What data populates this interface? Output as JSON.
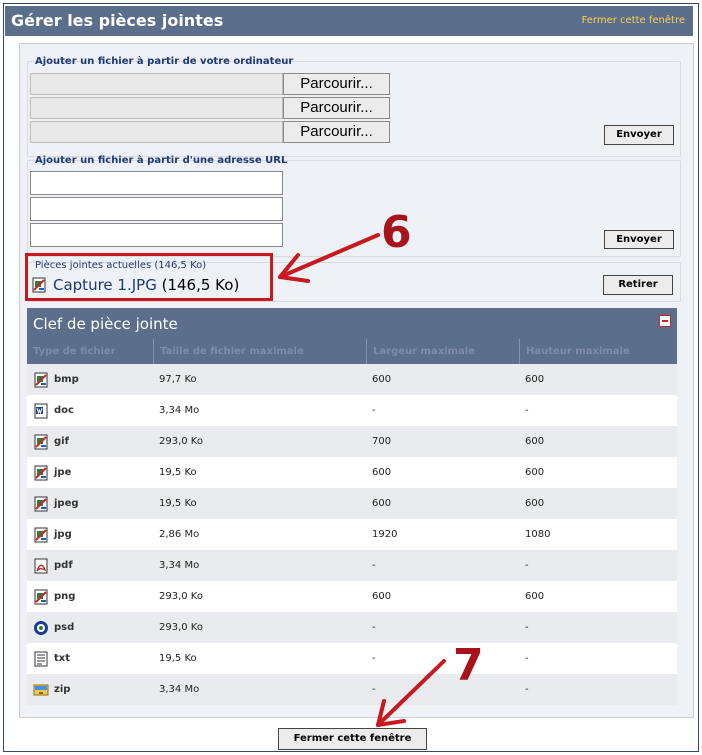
{
  "window": {
    "title": "Gérer les pièces jointes",
    "close_link": "Fermer cette fenêtre"
  },
  "upload_local": {
    "legend": "Ajouter un fichier à partir de votre ordinateur",
    "browse_label": "Parcourir...",
    "submit_label": "Envoyer"
  },
  "upload_url": {
    "legend": "Ajouter un fichier à partir d'une adresse URL",
    "submit_label": "Envoyer"
  },
  "current": {
    "legend": "Pièces jointes actuelles (146,5 Ko)",
    "file_name": "Capture 1.JPG",
    "file_size": "(146,5 Ko)",
    "remove_label": "Retirer"
  },
  "key": {
    "title": "Clef de pièce jointe",
    "columns": [
      "Type de fichier",
      "Taille de fichier maximale",
      "Largeur maximale",
      "Hauteur maximale"
    ],
    "rows": [
      {
        "type": "bmp",
        "icon": "image-icon",
        "size": "97,7 Ko",
        "width": "600",
        "height": "600"
      },
      {
        "type": "doc",
        "icon": "word-document-icon",
        "size": "3,34 Mo",
        "width": "-",
        "height": "-"
      },
      {
        "type": "gif",
        "icon": "image-icon",
        "size": "293,0 Ko",
        "width": "700",
        "height": "600"
      },
      {
        "type": "jpe",
        "icon": "image-icon",
        "size": "19,5 Ko",
        "width": "600",
        "height": "600"
      },
      {
        "type": "jpeg",
        "icon": "image-icon",
        "size": "19,5 Ko",
        "width": "600",
        "height": "600"
      },
      {
        "type": "jpg",
        "icon": "image-icon",
        "size": "2,86 Mo",
        "width": "1920",
        "height": "1080"
      },
      {
        "type": "pdf",
        "icon": "pdf-icon",
        "size": "3,34 Mo",
        "width": "-",
        "height": "-"
      },
      {
        "type": "png",
        "icon": "image-icon",
        "size": "293,0 Ko",
        "width": "600",
        "height": "600"
      },
      {
        "type": "psd",
        "icon": "photoshop-icon",
        "size": "293,0 Ko",
        "width": "-",
        "height": "-"
      },
      {
        "type": "txt",
        "icon": "text-file-icon",
        "size": "19,5 Ko",
        "width": "-",
        "height": "-"
      },
      {
        "type": "zip",
        "icon": "archive-icon",
        "size": "3,34 Mo",
        "width": "-",
        "height": "-"
      }
    ]
  },
  "footer": {
    "close_button": "Fermer cette fenêtre"
  },
  "annotations": {
    "marker_6": "6",
    "marker_7": "7"
  },
  "colors": {
    "header_bar": "#5b6e8c",
    "link_yellow": "#ffd24a",
    "annotation_red": "#c8191f",
    "legend_blue": "#1f3a75"
  }
}
